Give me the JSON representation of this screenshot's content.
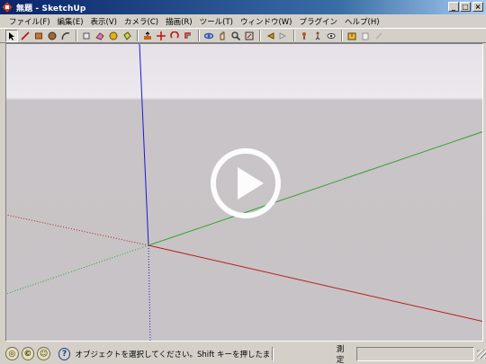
{
  "window": {
    "title": "無題 - SketchUp",
    "controls": {
      "minimize": "_",
      "maximize": "□",
      "close": "×"
    }
  },
  "menu": [
    {
      "label": "ファイル(F)"
    },
    {
      "label": "編集(E)"
    },
    {
      "label": "表示(V)"
    },
    {
      "label": "カメラ(C)"
    },
    {
      "label": "描画(R)"
    },
    {
      "label": "ツール(T)"
    },
    {
      "label": "ウィンドウ(W)"
    },
    {
      "label": "プラグイン"
    },
    {
      "label": "ヘルプ(H)"
    }
  ],
  "toolbar": {
    "tools": [
      {
        "icon": "select-icon",
        "active": true
      },
      {
        "icon": "line-icon"
      },
      {
        "icon": "rectangle-icon"
      },
      {
        "icon": "circle-icon"
      },
      {
        "icon": "arc-icon"
      },
      {
        "sep": true
      },
      {
        "icon": "make-component-icon"
      },
      {
        "icon": "eraser-icon"
      },
      {
        "icon": "tape-measure-icon"
      },
      {
        "icon": "paint-bucket-icon"
      },
      {
        "sep": true
      },
      {
        "icon": "push-pull-icon"
      },
      {
        "icon": "move-icon"
      },
      {
        "icon": "rotate-icon"
      },
      {
        "icon": "offset-icon"
      },
      {
        "sep": true
      },
      {
        "icon": "orbit-icon"
      },
      {
        "icon": "pan-icon"
      },
      {
        "icon": "zoom-icon"
      },
      {
        "icon": "zoom-extents-icon"
      },
      {
        "sep": true
      },
      {
        "icon": "previous-view-icon"
      },
      {
        "icon": "next-view-icon"
      },
      {
        "sep": true
      },
      {
        "icon": "position-camera-icon"
      },
      {
        "icon": "walk-icon"
      },
      {
        "icon": "look-around-icon"
      },
      {
        "sep": true
      },
      {
        "icon": "get-models-icon"
      },
      {
        "icon": "share-model-icon"
      },
      {
        "icon": "share-component-icon"
      }
    ]
  },
  "viewport": {
    "play_icon": "play-icon",
    "colors": {
      "red_axis": "#b81c1c",
      "green_axis": "#2fa52f",
      "blue_axis": "#1a1ad0"
    }
  },
  "status": {
    "icons": [
      "geo-location-icon",
      "credits-icon",
      "user-icon"
    ],
    "help_icon": "?",
    "text": "オブジェクトを選択してください。Shift キーを押したまま選択",
    "measure_label": "測定",
    "measure_value": ""
  }
}
